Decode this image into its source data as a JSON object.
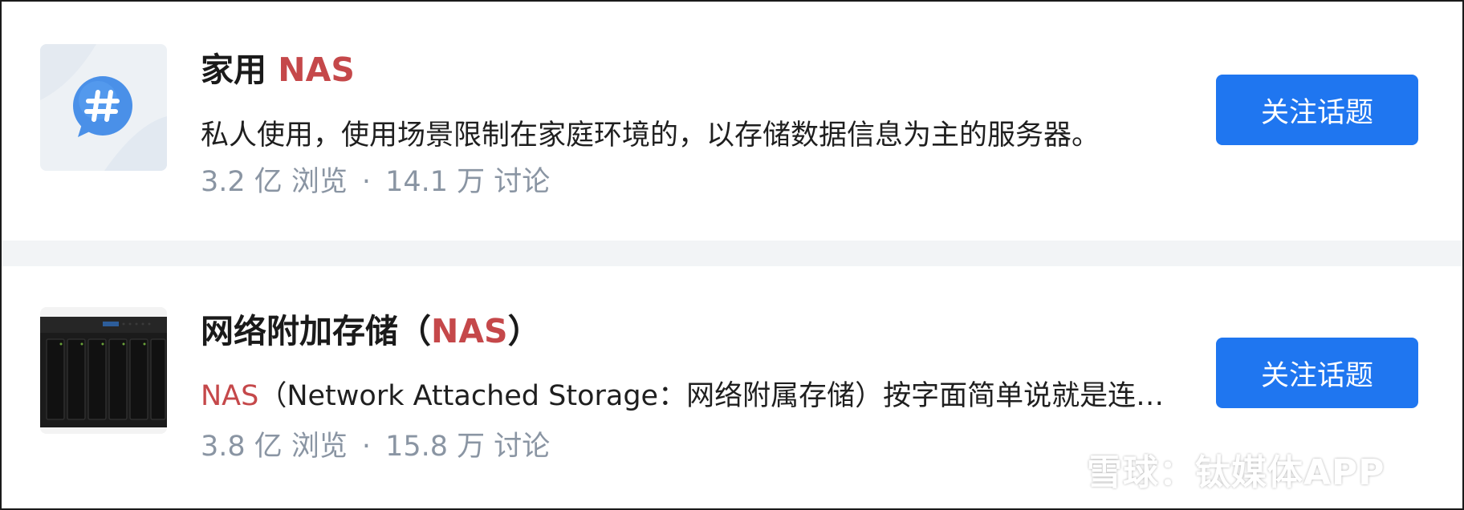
{
  "topics": [
    {
      "title_main": "家用 ",
      "title_highlight": "NAS",
      "title_suffix": "",
      "description_highlight": "",
      "description": "私人使用，使用场景限制在家庭环境的，以存储数据信息为主的服务器。",
      "views": "3.2 亿 浏览",
      "separator": "·",
      "discussions": "14.1 万 讨论",
      "follow_label": "关注话题",
      "thumbnail_icon": "hashtag-bubble-icon"
    },
    {
      "title_main": "网络附加存储（",
      "title_highlight": "NAS",
      "title_suffix": "）",
      "description_highlight": "NAS",
      "description": "（Network Attached Storage：网络附属存储）按字面简单说就是连…",
      "views": "3.8 亿 浏览",
      "separator": "·",
      "discussions": "15.8 万 讨论",
      "follow_label": "关注话题",
      "thumbnail_icon": "nas-device-image"
    }
  ],
  "watermark": {
    "text": "雪球：钛媒体APP",
    "logo": "xueqiu-logo-icon"
  },
  "colors": {
    "highlight": "#c5484a",
    "button": "#1f76f0",
    "meta_text": "#8a95a3",
    "separator_band": "#f2f4f6"
  }
}
